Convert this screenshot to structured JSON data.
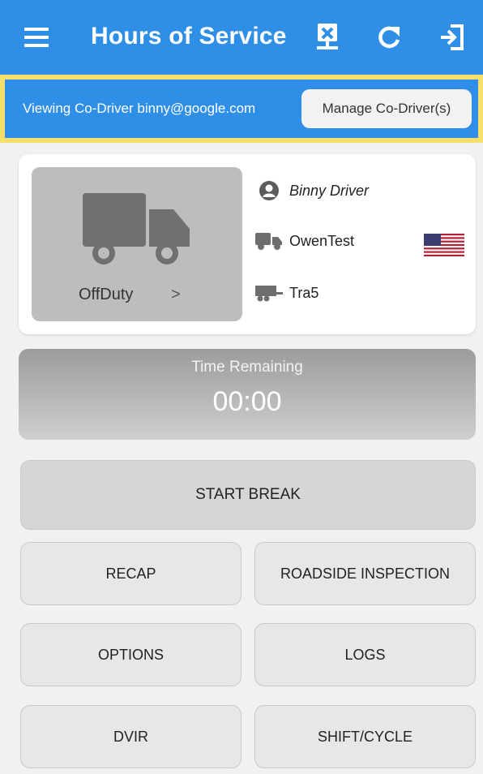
{
  "app": {
    "title": "Hours of Service",
    "icons": [
      "menu-icon",
      "close-log-icon",
      "refresh-icon",
      "logout-icon"
    ]
  },
  "codriver": {
    "viewing_text": "Viewing Co-Driver binny@google.com",
    "manage_label": "Manage Co-Driver(s)"
  },
  "status": {
    "label": "OffDuty",
    "chevron": ">"
  },
  "info": {
    "driver": "Binny Driver",
    "vehicle": "OwenTest",
    "trailer": "Tra5"
  },
  "timer": {
    "label": "Time Remaining",
    "value": "00:00"
  },
  "actions": {
    "start_break": "START BREAK",
    "recap": "RECAP",
    "roadside": "ROADSIDE INSPECTION",
    "options": "OPTIONS",
    "logs": "LOGS",
    "dvir": "DVIR",
    "shift_cycle": "SHIFT/CYCLE"
  },
  "colors": {
    "header_bg": "#2f8ee6",
    "codriver_border": "#f6df6d",
    "tile_bg": "#bdbdbd"
  }
}
